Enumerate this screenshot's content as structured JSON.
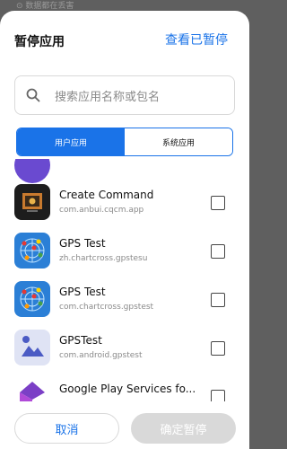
{
  "background": {
    "status_text": "⊙  数据都在丢害"
  },
  "dialog": {
    "title": "暂停应用",
    "view_paused_link": "查看已暂停",
    "search_placeholder": "搜索应用名称或包名",
    "tabs": [
      {
        "label": "用户应用",
        "active": true
      },
      {
        "label": "系统应用",
        "active": false
      }
    ]
  },
  "apps": [
    {
      "name": "Create Command",
      "package": "com.anbui.cqcm.app",
      "icon": "create-command-icon",
      "checked": false
    },
    {
      "name": "GPS Test",
      "package": "zh.chartcross.gpstesu",
      "icon": "gps-test-icon",
      "checked": false
    },
    {
      "name": "GPS Test",
      "package": "com.chartcross.gpstest",
      "icon": "gps-test-icon",
      "checked": false
    },
    {
      "name": "GPSTest",
      "package": "com.android.gpstest",
      "icon": "gpstest-map-icon",
      "checked": false
    },
    {
      "name": "Google Play Services fo...",
      "package": "",
      "icon": "google-play-services-icon",
      "checked": false
    }
  ],
  "buttons": {
    "cancel": "取消",
    "confirm": "确定暂停"
  },
  "colors": {
    "accent": "#1a73e8",
    "disabled": "#d9d9d9"
  }
}
